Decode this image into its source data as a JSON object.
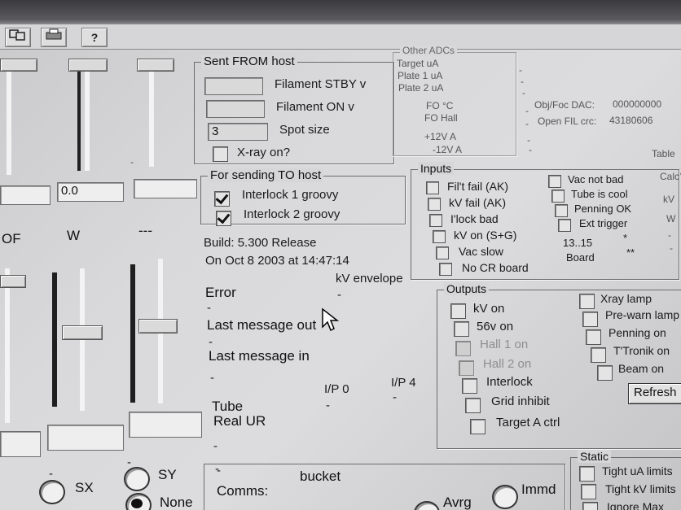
{
  "toolbar": {
    "help_label": "?"
  },
  "sliders": {
    "top_values": [
      "",
      "0.0",
      ""
    ],
    "labels": [
      "OF",
      "W",
      "---"
    ]
  },
  "sent_from_host": {
    "title": "Sent FROM host",
    "filament_stby_label": "Filament STBY v",
    "filament_stby_value": "",
    "filament_on_label": "Filament ON v",
    "filament_on_value": "",
    "spot_size_label": "Spot size",
    "spot_size_value": "3",
    "xray_on_label": "X-ray on?"
  },
  "sending_to_host": {
    "title": "For sending TO host",
    "interlock1_label": "Interlock 1 groovy",
    "interlock2_label": "Interlock 2 groovy"
  },
  "build": {
    "line1": "Build: 5.300 Release",
    "line2": "On Oct  8 2003 at 14:47:14"
  },
  "status": {
    "error_label": "Error",
    "error_value": "-",
    "kv_envelope_label": "kV envelope",
    "kv_envelope_value": "-",
    "last_out_label": "Last message out",
    "last_out_value": "-",
    "last_in_label": "Last message in",
    "last_in_value": "-",
    "tube_label": "Tube",
    "real_ur_label": "Real UR",
    "tube_value": "-",
    "real_ur_value": "-",
    "ip0_label": "I/P 0",
    "ip0_value": "-",
    "ip4_label": "I/P 4",
    "ip4_value": "-"
  },
  "other_adcs": {
    "title": "Other ADCs",
    "rows": [
      "Target uA",
      "Plate 1 uA",
      "Plate 2 uA",
      "FO °C",
      "FO Hall",
      "+12V A",
      "-12V A"
    ],
    "values": [
      "-",
      "-",
      "-",
      "-",
      "-",
      "-",
      "-"
    ],
    "obj_foc_dac_label": "Obj/Foc DAC:",
    "obj_foc_dac_value": "000000000",
    "open_fil_crc_label": "Open FIL crc:",
    "open_fil_crc_value": "43180606"
  },
  "inputs": {
    "title": "Inputs",
    "left": [
      "Fil't fail (AK)",
      "kV fail (AK)",
      "I'lock bad",
      "kV on (S+G)",
      "Vac slow",
      "No CR board"
    ],
    "right": [
      "Vac not bad",
      "Tube is cool",
      "Penning OK",
      "Ext trigger"
    ],
    "board_range": "13..15",
    "board_label": "Board",
    "star1": "*",
    "star2": "**"
  },
  "outputs": {
    "title": "Outputs",
    "left": [
      "kV on",
      "56v on",
      "Hall 1 on",
      "Hall 2 on",
      "Interlock",
      "Grid inhibit",
      "Target A ctrl"
    ],
    "left_disabled": [
      false,
      false,
      true,
      true,
      false,
      false,
      false
    ],
    "right": [
      "Xray lamp",
      "Pre-warn lamp",
      "Penning on",
      "T'Tronik on",
      "Beam on"
    ],
    "refresh_label": "Refresh"
  },
  "right_edge": {
    "table_label": "Table",
    "calc_label": "Calc'",
    "kv_label": "kV",
    "w_label": "W",
    "dash1": "-",
    "dash2": "-"
  },
  "static": {
    "title": "Static",
    "items": [
      "Tight uA limits",
      "Tight kV limits",
      "Ignore Max"
    ]
  },
  "bottom": {
    "sx_label": "SX",
    "sy_label": "SY",
    "none_label": "None",
    "comms_label": "Comms:",
    "comms_value": "bucket",
    "avrg_label": "Avrg",
    "immd_label": "Immd",
    "dash1": "-",
    "dash2": "-",
    "dash3": "-"
  }
}
